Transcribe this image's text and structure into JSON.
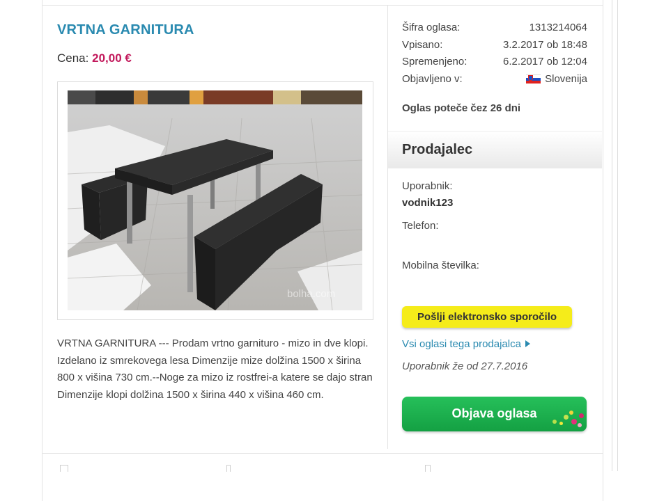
{
  "ad": {
    "title": "VRTNA GARNITURA",
    "price_label": "Cena:",
    "price_value": "20,00 €",
    "description_line1": "VRTNA GARNITURA --- Prodam vrtno garnituro - mizo in dve klopi. Izdelano iz smrekovega lesa Dimenzije mize dolžina 1500 x širina 800 x višina 730 cm.--Noge za mizo iz rostfrei-a katere se dajo stran",
    "description_line2": "Dimenzije klopi dolžina 1500 x širina 440 x višina 460 cm.",
    "watermark": "bolha.com"
  },
  "meta": {
    "code_label": "Šifra oglasa:",
    "code_value": "1313214064",
    "entered_label": "Vpisano:",
    "entered_value": "3.2.2017 ob 18:48",
    "changed_label": "Spremenjeno:",
    "changed_value": "6.2.2017 ob 12:04",
    "published_label": "Objavljeno v:",
    "published_value": "Slovenija",
    "expiry": "Oglas poteče čez 26 dni"
  },
  "seller": {
    "heading": "Prodajalec",
    "user_label": "Uporabnik:",
    "user_value": "vodnik123",
    "phone_label": "Telefon:",
    "mobile_label": "Mobilna številka:",
    "email_button": "Pošlji elektronsko sporočilo",
    "all_ads_link": "Vsi oglasi tega prodajalca",
    "member_since": "Uporabnik že od 27.7.2016"
  },
  "cta": {
    "publish_button": "Objava oglasa"
  },
  "colors": {
    "title": "#2a8ab0",
    "price": "#c2185b",
    "yellow_button": "#f5ec1a",
    "green_button": "#1aa84a"
  },
  "icons": [
    "slovenia-flag-icon",
    "triangle-right-icon"
  ]
}
